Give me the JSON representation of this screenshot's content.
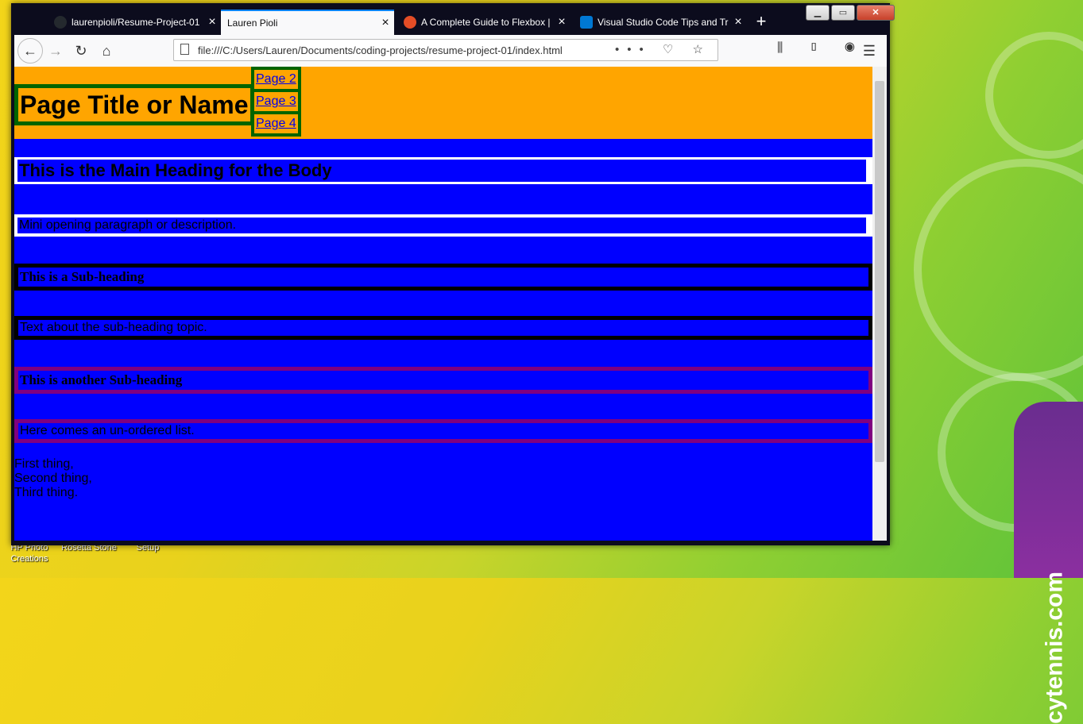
{
  "desktop": {
    "icons": [
      {
        "label": "HP Photo Creations"
      },
      {
        "label": "Rosetta Stone"
      },
      {
        "label": "Setup"
      }
    ],
    "wallpaper_brand": "cytennis.com"
  },
  "browser": {
    "tabs": [
      {
        "label": "laurenpioli/Resume-Project-01",
        "active": false,
        "icon": "github-icon"
      },
      {
        "label": "Lauren Pioli",
        "active": true,
        "icon": ""
      },
      {
        "label": "A Complete Guide to Flexbox |",
        "active": false,
        "icon": "css-tricks-icon"
      },
      {
        "label": "Visual Studio Code Tips and Tr",
        "active": false,
        "icon": "vscode-icon"
      }
    ],
    "close_glyph": "×",
    "new_tab_glyph": "+",
    "window_controls": {
      "minimize": "▁",
      "maximize": "▭",
      "close": "✕"
    },
    "url": "file:///C:/Users/Lauren/Documents/coding-projects/resume-project-01/index.html",
    "url_actions": "••• ♡ ☆",
    "toolbar_icons": "⫼ ▯ ◉",
    "menu_glyph": "☰",
    "nav": {
      "back": "←",
      "forward": "→",
      "reload": "↻",
      "home": "⌂"
    }
  },
  "page": {
    "title": "Page Title or Name",
    "nav_links": [
      "Page 2",
      "Page 3",
      "Page 4"
    ],
    "main_heading": "This is the Main Heading for the Body",
    "intro": "Mini opening paragraph or description.",
    "sub1_heading": "This is a Sub-heading",
    "sub1_text": "Text about the sub-heading topic.",
    "sub2_heading": "This is another Sub-heading",
    "sub2_text": "Here comes an un-ordered list.",
    "list": [
      "First thing,",
      "Second thing,",
      "Third thing."
    ]
  },
  "colors": {
    "header_bg": "#ffa500",
    "body_bg": "#0000ff",
    "title_border": "#006400",
    "sub2_border": "#800080",
    "sub1_border": "#000000"
  }
}
